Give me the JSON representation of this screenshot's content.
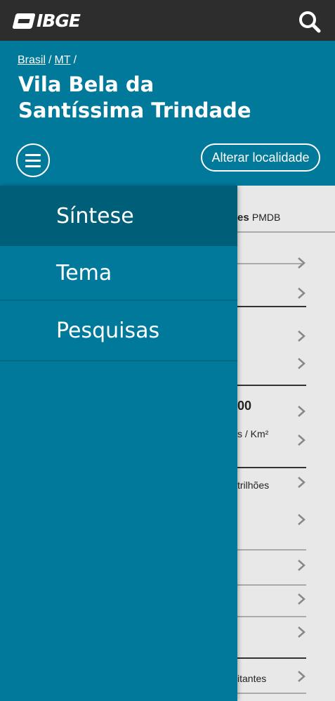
{
  "topbar": {
    "logo_text": "IBGE",
    "search_icon": "search-icon"
  },
  "header": {
    "breadcrumb": [
      {
        "label": "Brasil"
      },
      {
        "label": "MT"
      }
    ],
    "breadcrumb_separator": "/",
    "title_line1": "Vila Bela da",
    "title_line2": "Santíssima Trindade",
    "menu_icon": "hamburger-icon",
    "change_location_label": "Alterar localidade"
  },
  "drawer": {
    "items": [
      {
        "label": "Síntese",
        "active": true
      },
      {
        "label": "Tema",
        "active": false
      },
      {
        "label": "Pesquisas",
        "active": false
      }
    ]
  },
  "background_content": {
    "mayor_party_fragment_bold": "es",
    "mayor_party_fragment": "PMDB",
    "population_fragment": "00",
    "density_unit_fragment": "s / Km²",
    "gdp_fragment": "trilhões",
    "bottom_fragment": "itantes"
  },
  "colors": {
    "topbar_bg": "#2d2d2d",
    "header_bg": "#00799a",
    "drawer_bg": "#00799a",
    "drawer_active_bg": "#005f78",
    "content_bg": "#e8e8e8"
  }
}
